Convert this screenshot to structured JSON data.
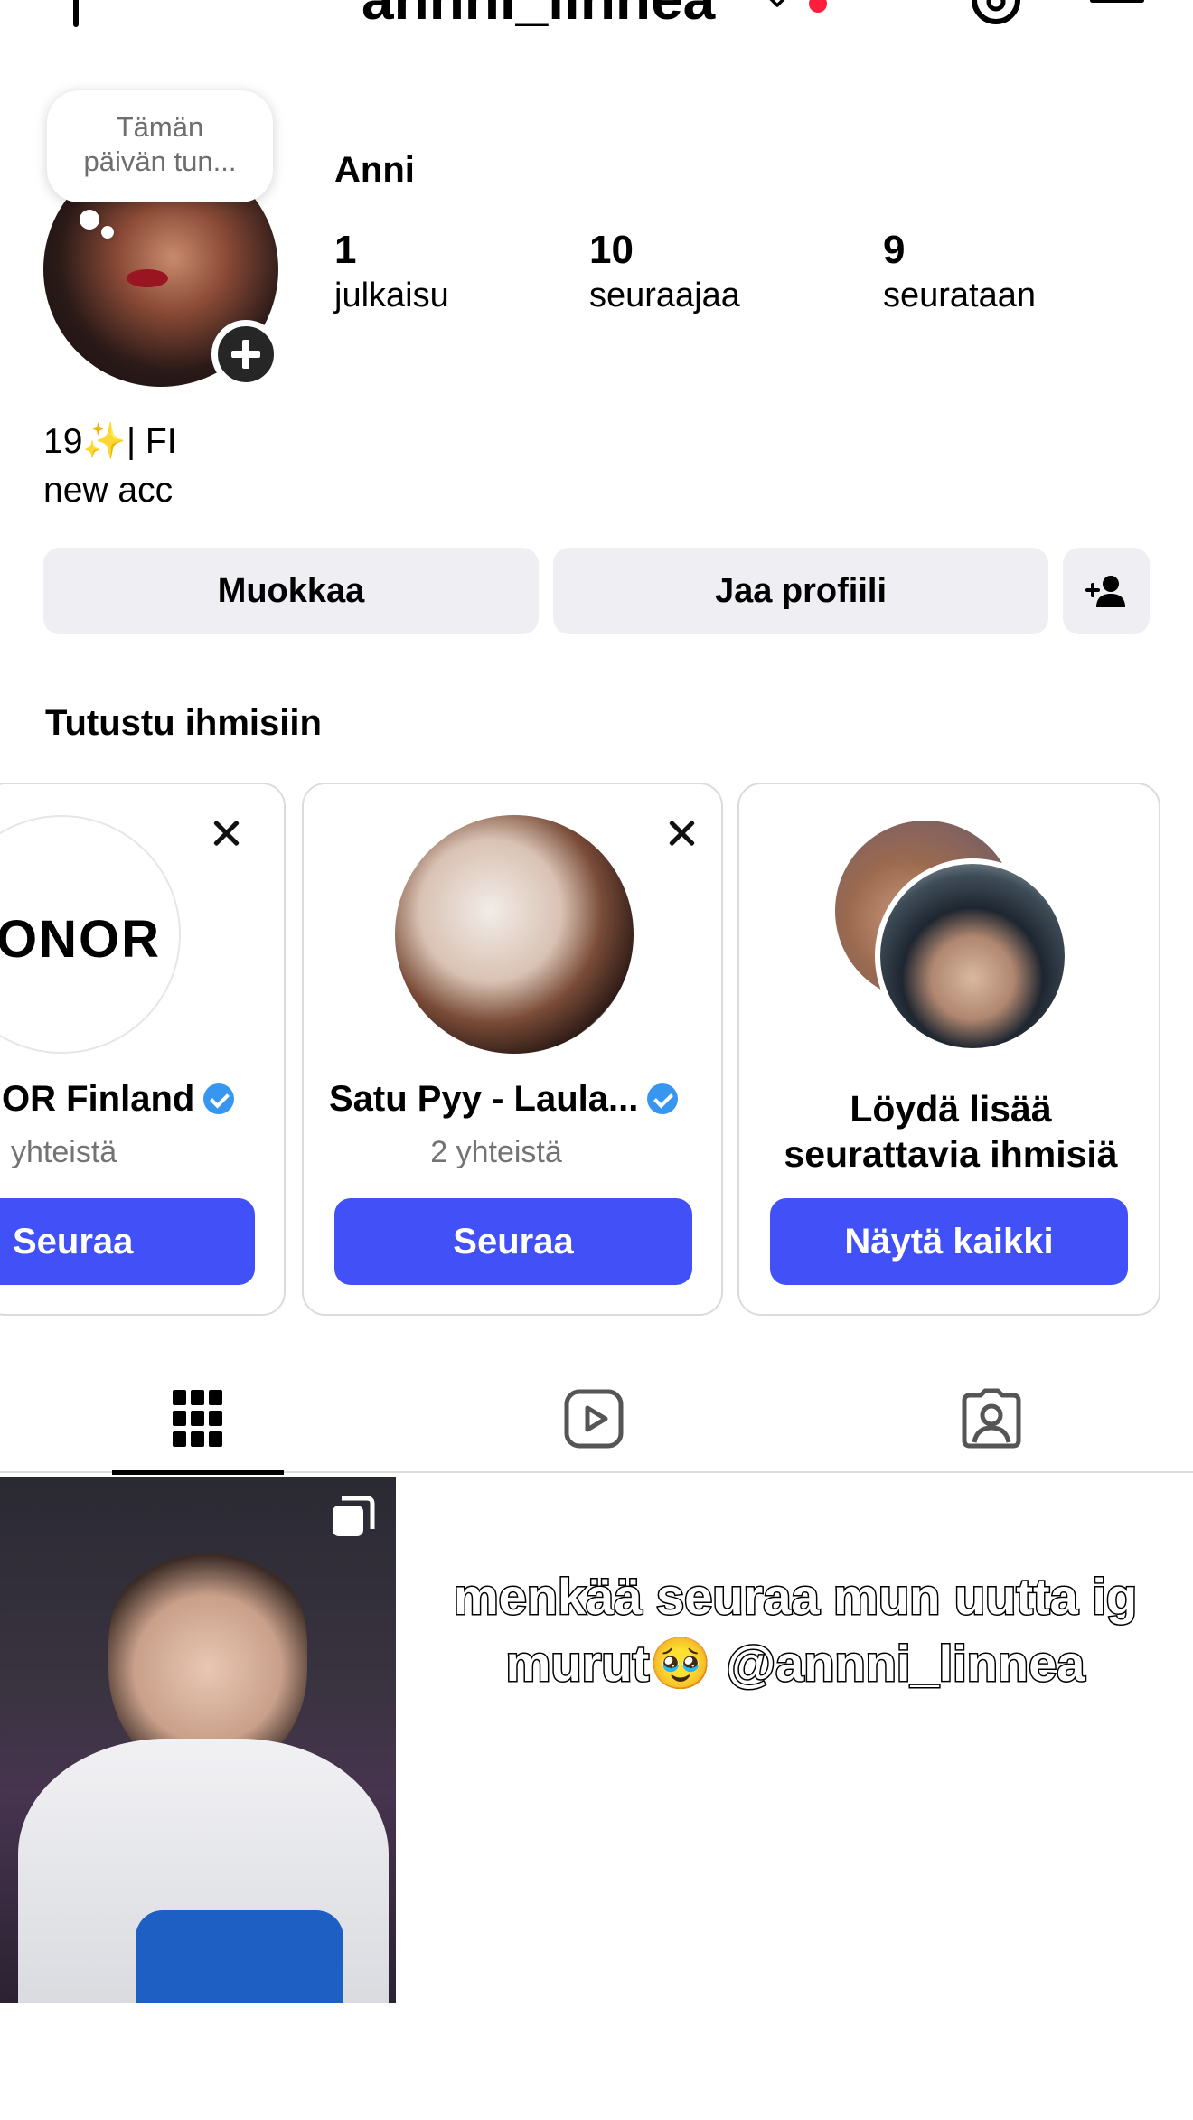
{
  "header": {
    "username": "annni_linnea",
    "new_post_icon": "plus-icon",
    "threads_icon": "threads-icon",
    "menu_icon": "hamburger-menu-icon"
  },
  "profile": {
    "note": "Tämän päivän tun...",
    "name": "Anni",
    "stats": [
      {
        "value": "1",
        "label": "julkaisu"
      },
      {
        "value": "10",
        "label": "seuraajaa"
      },
      {
        "value": "9",
        "label": "seurataan"
      }
    ],
    "bio_line1": "19✨| FI",
    "bio_line2": "new acc"
  },
  "actions": {
    "edit": "Muokkaa",
    "share": "Jaa profiili",
    "discover_icon": "add-person-icon"
  },
  "suggestions": {
    "title": "Tutustu ihmisiin",
    "cards": [
      {
        "name": "OR Finland",
        "logo": "IONOR",
        "sub": "yhteistä",
        "button": "Seuraa",
        "verified": true
      },
      {
        "name": "Satu Pyy - Laula...",
        "sub": "2 yhteistä",
        "button": "Seuraa",
        "verified": true
      },
      {
        "name_line1": "Löydä lisää",
        "name_line2": "seurattavia ihmisiä",
        "button": "Näytä kaikki"
      }
    ]
  },
  "tabs": [
    "grid-icon",
    "reels-icon",
    "tagged-icon"
  ],
  "post": {
    "caption_line1": "menkää seuraa mun uutta ig",
    "caption_line2": "murut🥹 @annni_linnea"
  },
  "colors": {
    "accent": "#4150f7",
    "verified": "#3797f0",
    "notification": "#ff1f3d",
    "button_bg": "#efeff3"
  }
}
